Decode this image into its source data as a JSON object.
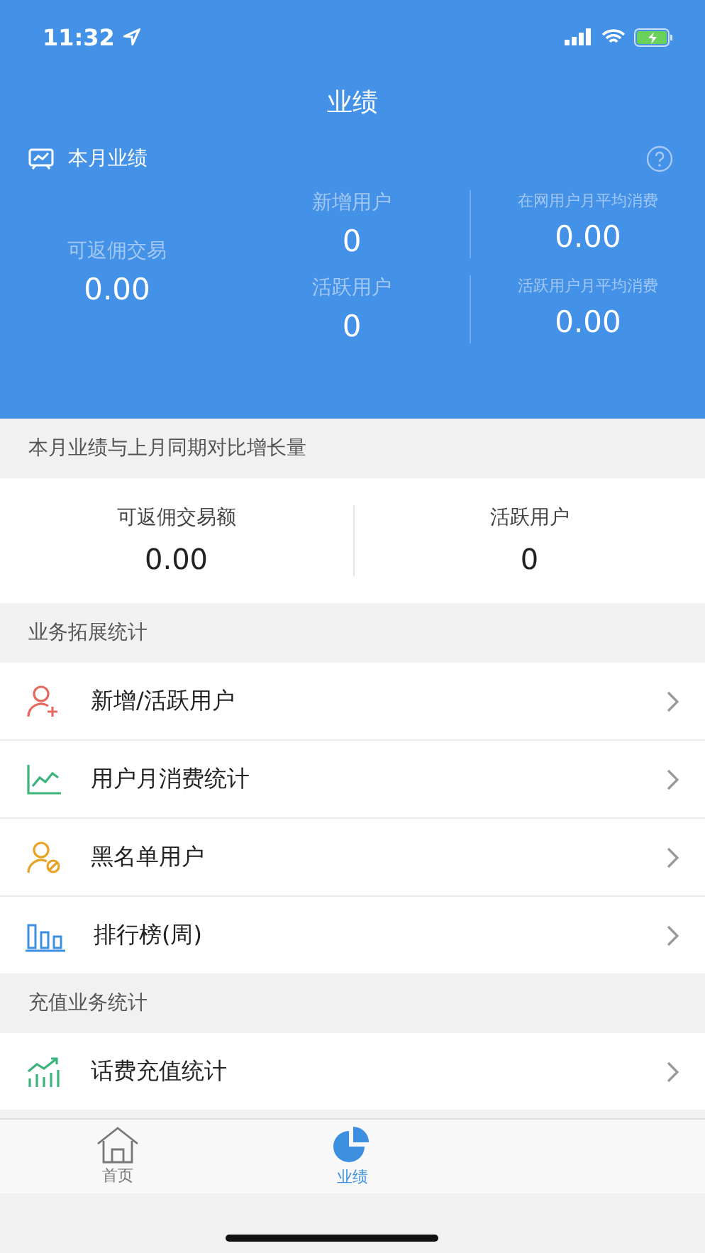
{
  "status_bar": {
    "time": "11:32"
  },
  "header": {
    "title": "业绩"
  },
  "summary": {
    "title": "本月业绩",
    "main": {
      "label": "可返佣交易",
      "value": "0.00"
    },
    "stats": [
      {
        "label": "新增用户",
        "value": "0"
      },
      {
        "label": "在网用户月平均消费",
        "value": "0.00"
      },
      {
        "label": "活跃用户",
        "value": "0"
      },
      {
        "label": "活跃用户月平均消费",
        "value": "0.00"
      }
    ]
  },
  "comparison": {
    "title": "本月业绩与上月同期对比增长量",
    "items": [
      {
        "label": "可返佣交易额",
        "value": "0.00"
      },
      {
        "label": "活跃用户",
        "value": "0"
      }
    ]
  },
  "sections": [
    {
      "title": "业务拓展统计",
      "items": [
        {
          "label": "新增/活跃用户",
          "kind": "user-add"
        },
        {
          "label": "用户月消费统计",
          "kind": "line"
        },
        {
          "label": "黑名单用户",
          "kind": "user-block"
        },
        {
          "label": "排行榜(周)",
          "kind": "bars"
        }
      ]
    },
    {
      "title": "充值业务统计",
      "items": [
        {
          "label": "话费充值统计",
          "kind": "rise"
        }
      ]
    }
  ],
  "tab_bar": [
    {
      "label": "首页",
      "kind": "home",
      "selected": false
    },
    {
      "label": "业绩",
      "kind": "pie",
      "selected": true
    }
  ]
}
